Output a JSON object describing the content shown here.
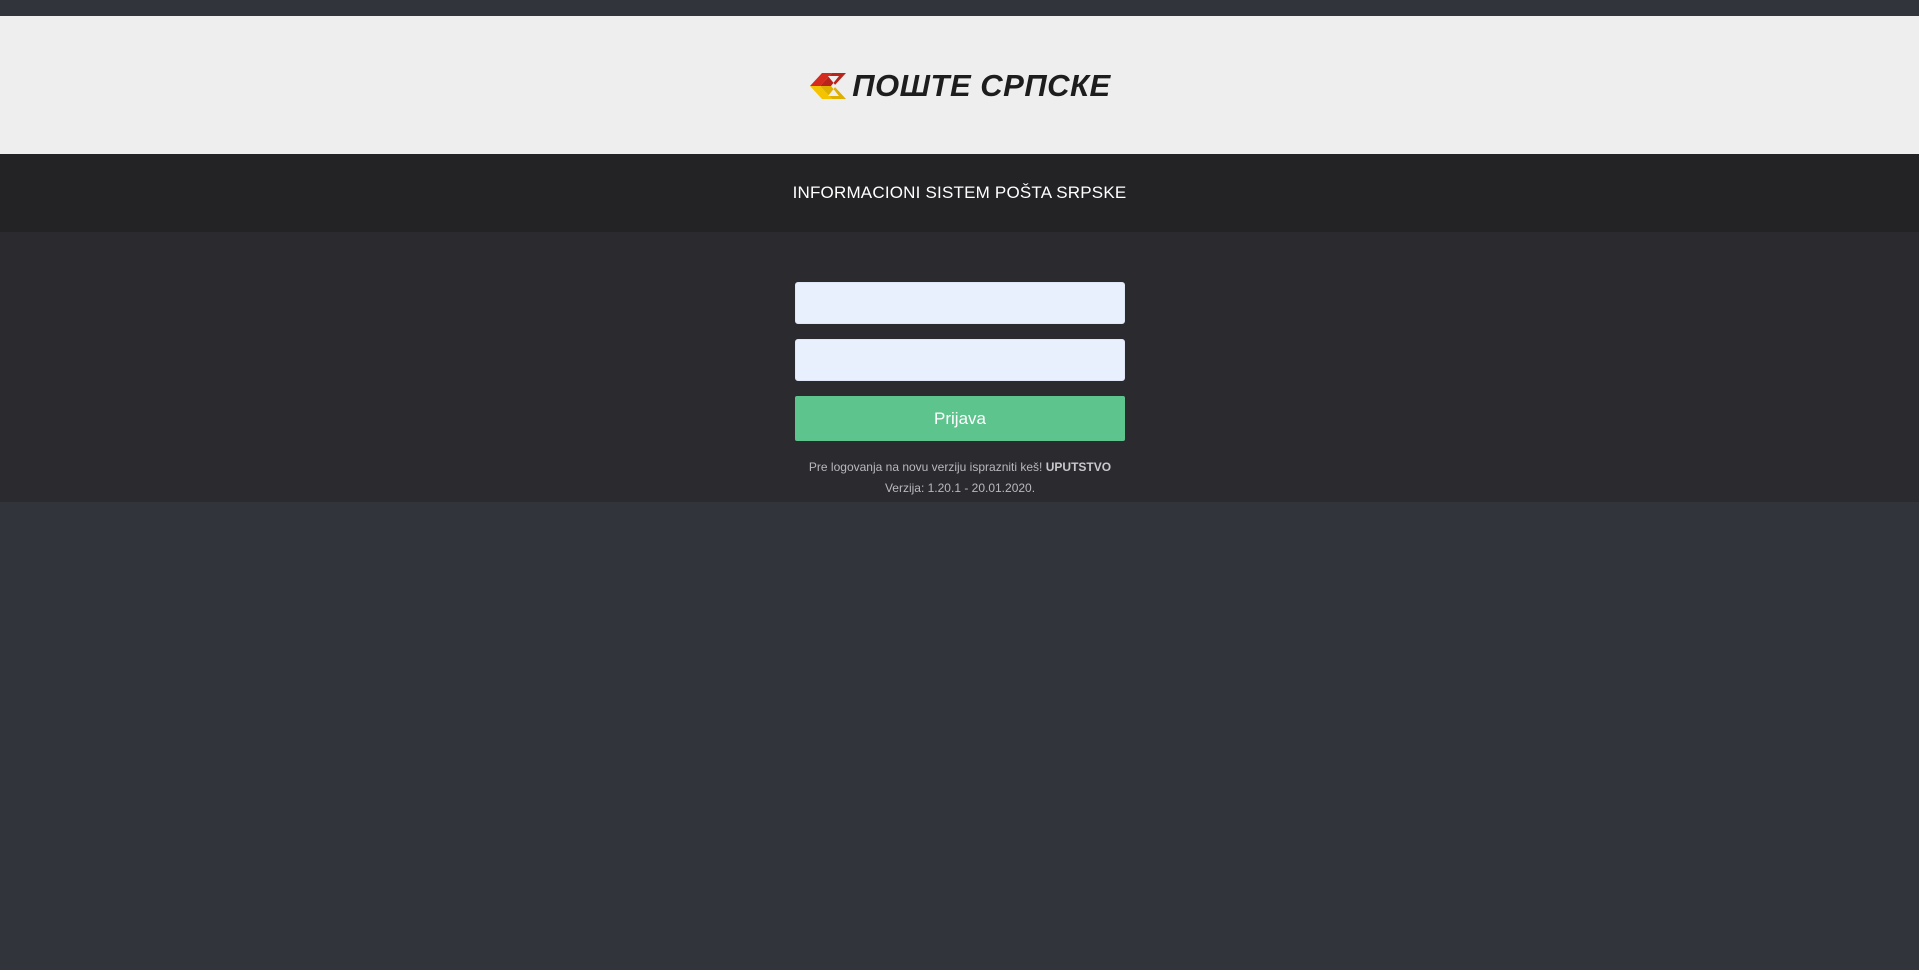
{
  "header": {
    "logo_text": "ПОШТЕ СРПСКЕ",
    "logo_colors": [
      "#d52b1e",
      "#f5c400"
    ]
  },
  "title_bar": {
    "system_title": "INFORMACIONI SISTEM POŠTA SRPSKE"
  },
  "login": {
    "username": {
      "value": "",
      "placeholder": ""
    },
    "password": {
      "value": "",
      "placeholder": ""
    },
    "submit_label": "Prijava",
    "submit_color": "#5dc48d"
  },
  "footer_notes": {
    "cache_notice": "Pre logovanja na novu verziju isprazniti keš!",
    "guide_link": "UPUTSTVO",
    "version": "Verzija: 1.20.1 - 20.01.2020."
  }
}
